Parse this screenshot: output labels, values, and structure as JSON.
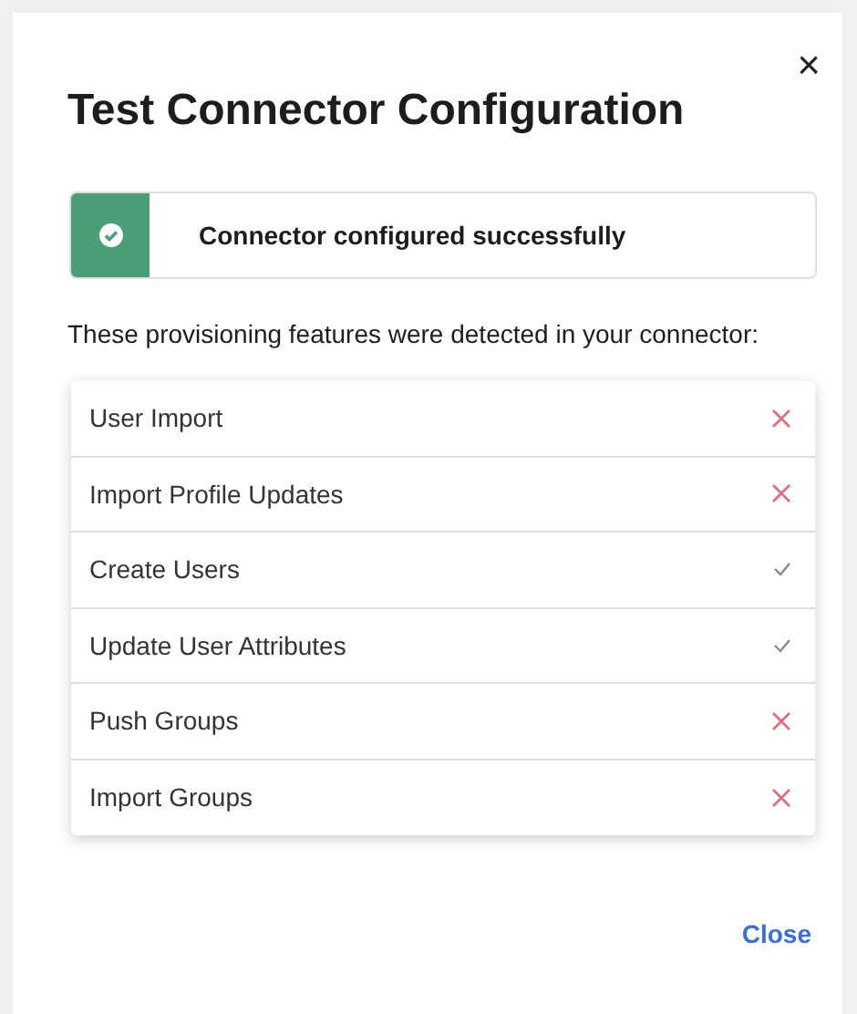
{
  "dialog": {
    "title": "Test Connector Configuration",
    "close_symbol": "×"
  },
  "banner": {
    "kind": "success",
    "message": "Connector configured successfully"
  },
  "intro": "These provisioning features were detected in your connector:",
  "features": [
    {
      "name": "User Import",
      "detected": false
    },
    {
      "name": "Import Profile Updates",
      "detected": false
    },
    {
      "name": "Create Users",
      "detected": true
    },
    {
      "name": "Update User Attributes",
      "detected": true
    },
    {
      "name": "Push Groups",
      "detected": false
    },
    {
      "name": "Import Groups",
      "detected": false
    }
  ],
  "footer": {
    "close_label": "Close"
  }
}
